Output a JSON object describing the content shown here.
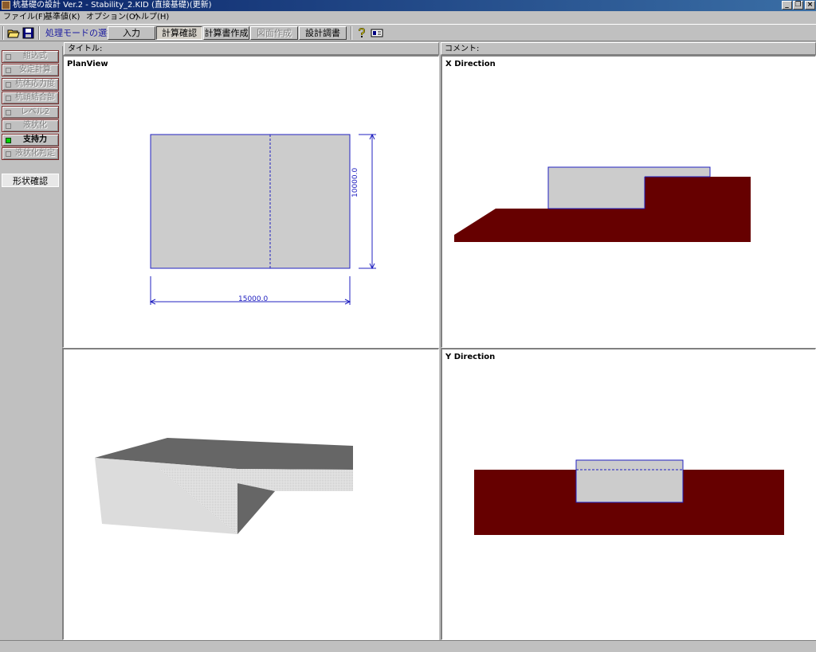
{
  "window": {
    "title": "杭基礎の設計 Ver.2 - Stability_2.KID (直接基礎)(更新)",
    "minimize": "_",
    "maximize": "❐",
    "close": "×"
  },
  "menu": [
    "ファイル(F)",
    "基準値(K)",
    "オプション(O)",
    "ヘルプ(H)"
  ],
  "toolbar": {
    "mode_label": "処理モードの選択",
    "buttons": {
      "input": "入力",
      "calc_check": "計算確認",
      "report_create": "計算書作成",
      "drawing_create": "図面作成",
      "design_investigation": "設計調書"
    },
    "active": "計算確認"
  },
  "sidebar": {
    "items": [
      {
        "label": "組込式",
        "state": "disabled"
      },
      {
        "label": "安定計算",
        "state": "disabled"
      },
      {
        "label": "杭体応力度",
        "state": "disabled"
      },
      {
        "label": "杭頭結合部",
        "state": "disabled"
      },
      {
        "label": "レベル2",
        "state": "disabled"
      },
      {
        "label": "液状化",
        "state": "disabled"
      },
      {
        "label": "支持力",
        "state": "enabled"
      },
      {
        "label": "液状化判定",
        "state": "disabled"
      }
    ],
    "shape_check": "形状確認"
  },
  "headers": {
    "title_label": "タイトル:",
    "comment_label": "コメント:"
  },
  "panels": {
    "plan_view": {
      "title": "PlanView",
      "width_dim": "15000.0",
      "height_dim": "10000.0"
    },
    "x_direction": {
      "title": "X Direction"
    },
    "y_direction": {
      "title": "Y Direction"
    },
    "iso_view": {
      "title": ""
    }
  },
  "colors": {
    "footing": "#cccccc",
    "outline": "#2020c0",
    "ground": "#660000",
    "title_bar": "#0a246a"
  }
}
